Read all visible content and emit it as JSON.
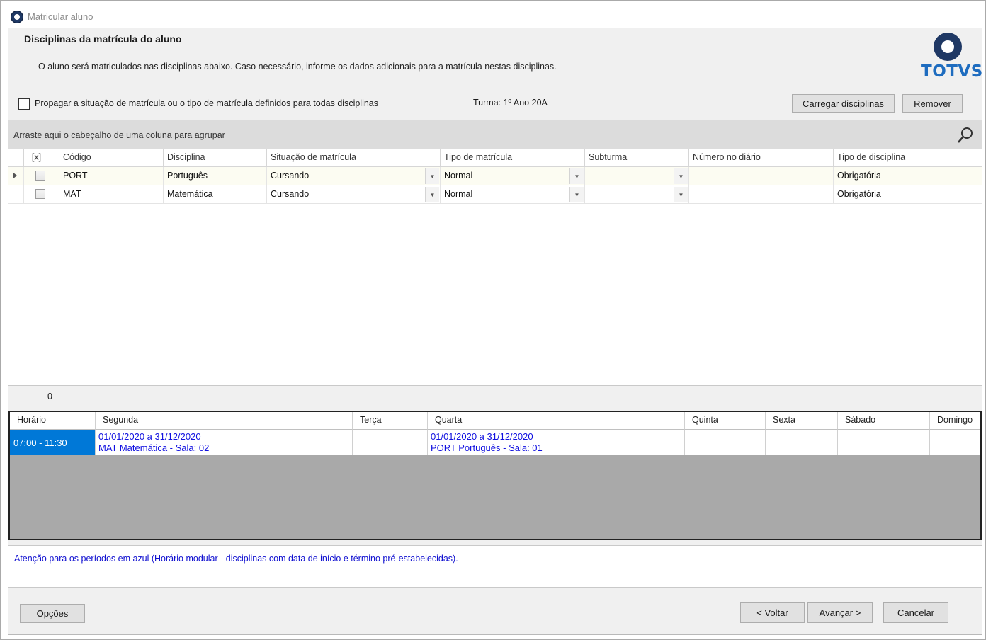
{
  "window": {
    "title": "Matricular aluno"
  },
  "header": {
    "title": "Disciplinas da matrícula do aluno",
    "description": "O aluno será matriculados nas disciplinas abaixo. Caso necessário, informe os dados adicionais para a matrícula nestas disciplinas.",
    "logo_text": "TOTVS",
    "logo_color": "#1e6cbf"
  },
  "options": {
    "propagate_label": "Propagar a situação de matrícula ou o tipo de matrícula definidos para todas disciplinas",
    "propagate_checked": false,
    "turma_label": "Turma: 1º Ano 20A",
    "load_button": "Carregar disciplinas",
    "remove_button": "Remover"
  },
  "grid": {
    "group_hint": "Arraste aqui o cabeçalho de uma coluna para agrupar",
    "columns": [
      "[x]",
      "Código",
      "Disciplina",
      "Situação de matrícula",
      "Tipo de matrícula",
      "Subturma",
      "Número no diário",
      "Tipo de disciplina"
    ],
    "rows": [
      {
        "checked": false,
        "codigo": "PORT",
        "disciplina": "Português",
        "situacao": "Cursando",
        "tipo": "Normal",
        "subturma": "",
        "numero": "",
        "tipo_disciplina": "Obrigatória"
      },
      {
        "checked": false,
        "codigo": "MAT",
        "disciplina": "Matemática",
        "situacao": "Cursando",
        "tipo": "Normal",
        "subturma": "",
        "numero": "",
        "tipo_disciplina": "Obrigatória"
      }
    ],
    "footer_count": "0"
  },
  "schedule": {
    "columns": [
      "Horário",
      "Segunda",
      "Terça",
      "Quarta",
      "Quinta",
      "Sexta",
      "Sábado",
      "Domingo"
    ],
    "row": {
      "time": "07:00 - 11:30",
      "segunda_line1": "01/01/2020 a 31/12/2020",
      "segunda_line2": "MAT  Matemática - Sala: 02",
      "quarta_line1": "01/01/2020 a 31/12/2020",
      "quarta_line2": "PORT  Português - Sala: 01"
    },
    "highlight_color": "#0078d7"
  },
  "note": "Atenção para os períodos em azul (Horário modular - disciplinas com data de início e término pré-estabelecidas).",
  "buttons": {
    "options": "Opções",
    "back": "< Voltar",
    "next": "Avançar >",
    "cancel": "Cancelar"
  }
}
